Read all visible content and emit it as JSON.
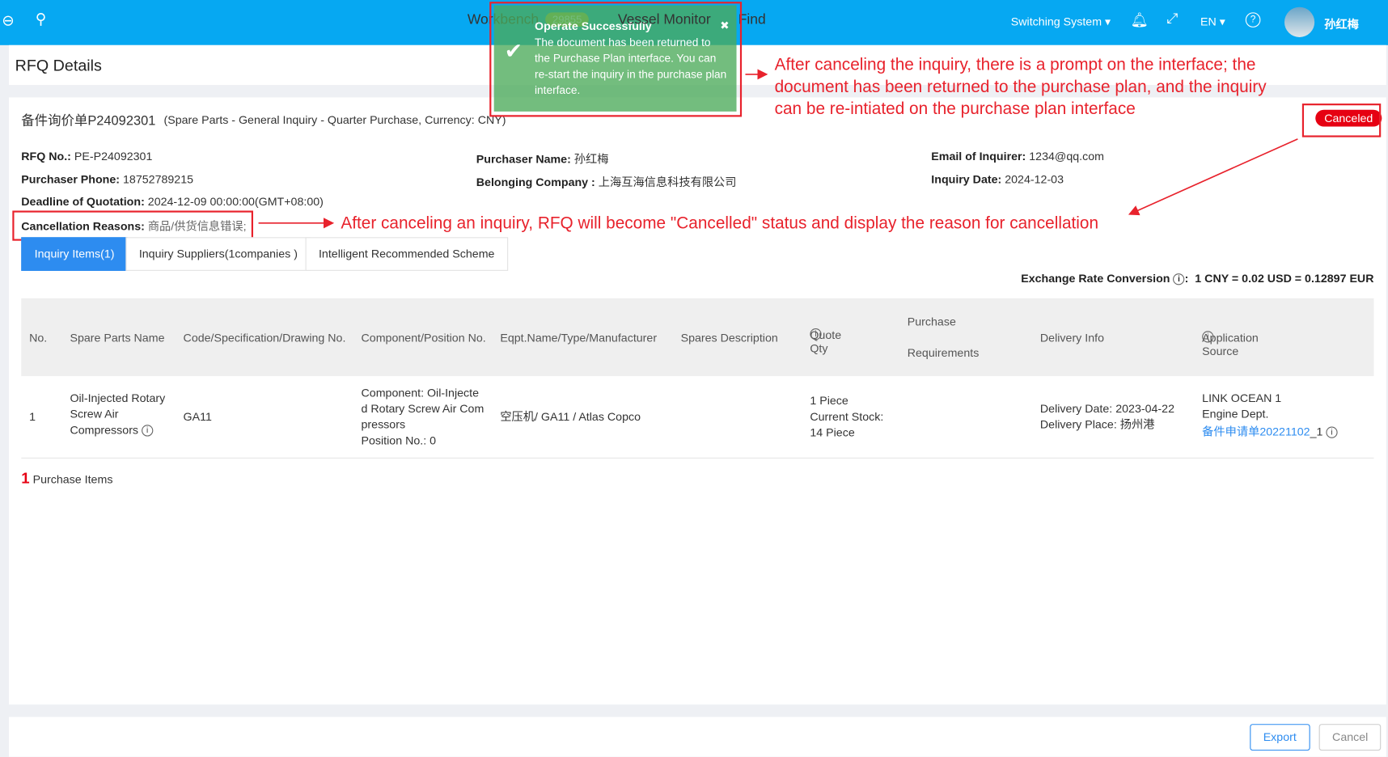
{
  "header": {
    "nav": [
      "Workbench",
      "29855",
      "Vessel Monitor",
      "Find"
    ],
    "switching": "Switching System ▾",
    "lang": "EN ▾",
    "user": "孙红梅",
    "color": "#06a8f2"
  },
  "toast": {
    "title": "Operate Successfully",
    "message": "The document has been returned to the Purchase Plan interface. You can re-start the inquiry in the purchase plan interface.",
    "close": "✖"
  },
  "page_title": "RFQ Details",
  "rfq": {
    "title": "备件询价单P24092301",
    "subtitle": "(Spare Parts - General Inquiry - Quarter Purchase, Currency: CNY)",
    "status": "Canceled",
    "fields": [
      {
        "label": "RFQ No.:",
        "value": "PE-P24092301"
      },
      {
        "label": "Purchaser Name:",
        "value": "孙红梅"
      },
      {
        "label": "Email of Inquirer:",
        "value": "1234@qq.com"
      },
      {
        "label": "Purchaser Phone:",
        "value": "18752789215"
      },
      {
        "label": "Belonging Company :",
        "value": "上海互海信息科技有限公司"
      },
      {
        "label": "Inquiry Date:",
        "value": "2024-12-03"
      },
      {
        "label": "Deadline of Quotation:",
        "value": "2024-12-09 00:00:00(GMT+08:00)"
      },
      {
        "label": "Cancellation Reasons:",
        "value": "商品/供货信息错误;"
      }
    ]
  },
  "tabs": [
    "Inquiry Items(1)",
    "Inquiry Suppliers(1companies )",
    "Intelligent Recommended Scheme"
  ],
  "exchange": {
    "label": "Exchange Rate Conversion",
    "value": "1 CNY = 0.02 USD = 0.12897 EUR"
  },
  "table": {
    "headers": [
      "No.",
      "Spare Parts Name",
      "Code/Specification/Drawing No.",
      "Component/Position No.",
      "Eqpt.Name/Type/Manufacturer",
      "Spares Description",
      "Quote Qty",
      "Purchase",
      "Requirements",
      "Delivery Info",
      "Application Source"
    ],
    "row": {
      "no": "1",
      "name": "Oil-Injected Rotary Screw Air Compressors",
      "code": "GA11",
      "component": "Component:  Oil-Injected Rotary Screw Air Compressors",
      "position": "Position No.:  0",
      "eqpt": "空压机/ GA11 / Atlas Copco",
      "qty": "1 Piece",
      "stock_label": "Current Stock:",
      "stock": "14 Piece",
      "delivery_date": "Delivery Date:   2023-04-22",
      "delivery_place": "Delivery Place:  扬州港",
      "source1": "LINK OCEAN 1",
      "source2": "Engine Dept.",
      "source_link": "备件申请单20221102",
      "source_suffix": "_1"
    }
  },
  "summary": {
    "count": "1",
    "label": "Purchase Items"
  },
  "footer": {
    "export": "Export",
    "cancel": "Cancel"
  },
  "annotations": {
    "a1": "After canceling the inquiry, there is a prompt on the interface; the document has been returned to the purchase plan, and the  inquiry can be re-intiated on the purchase plan interface",
    "a2": "After canceling an inquiry, RFQ will become \"Cancelled\" status and display the reason for cancellation",
    "color": "#e8222c"
  }
}
